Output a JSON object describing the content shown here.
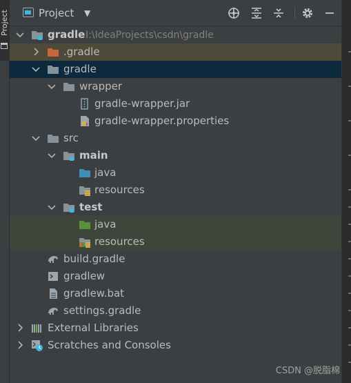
{
  "sidebar": {
    "project_tab": "Project"
  },
  "header": {
    "title": "Project",
    "icons": [
      "crosshair-icon",
      "expand-all-icon",
      "collapse-all-icon",
      "gear-icon",
      "hide-icon"
    ]
  },
  "tree": {
    "root": {
      "label": "gradle",
      "path": "I:\\IdeaProjects\\csdn\\gradle"
    },
    "items": [
      {
        "label": ".gradle"
      },
      {
        "label": "gradle"
      },
      {
        "label": "wrapper"
      },
      {
        "label": "gradle-wrapper.jar"
      },
      {
        "label": "gradle-wrapper.properties"
      },
      {
        "label": "src"
      },
      {
        "label": "main"
      },
      {
        "label": "java"
      },
      {
        "label": "resources"
      },
      {
        "label": "test"
      },
      {
        "label": "java"
      },
      {
        "label": "resources"
      },
      {
        "label": "build.gradle"
      },
      {
        "label": "gradlew"
      },
      {
        "label": "gradlew.bat"
      },
      {
        "label": "settings.gradle"
      },
      {
        "label": "External Libraries"
      },
      {
        "label": "Scratches and Consoles"
      }
    ]
  },
  "watermark": "CSDN @脱脂棉",
  "colors": {
    "folder": "#87939a",
    "source": "#3d8fb8",
    "test": "#5c8f3c",
    "excluded": "#c7663e",
    "selected": "#0d293e"
  }
}
